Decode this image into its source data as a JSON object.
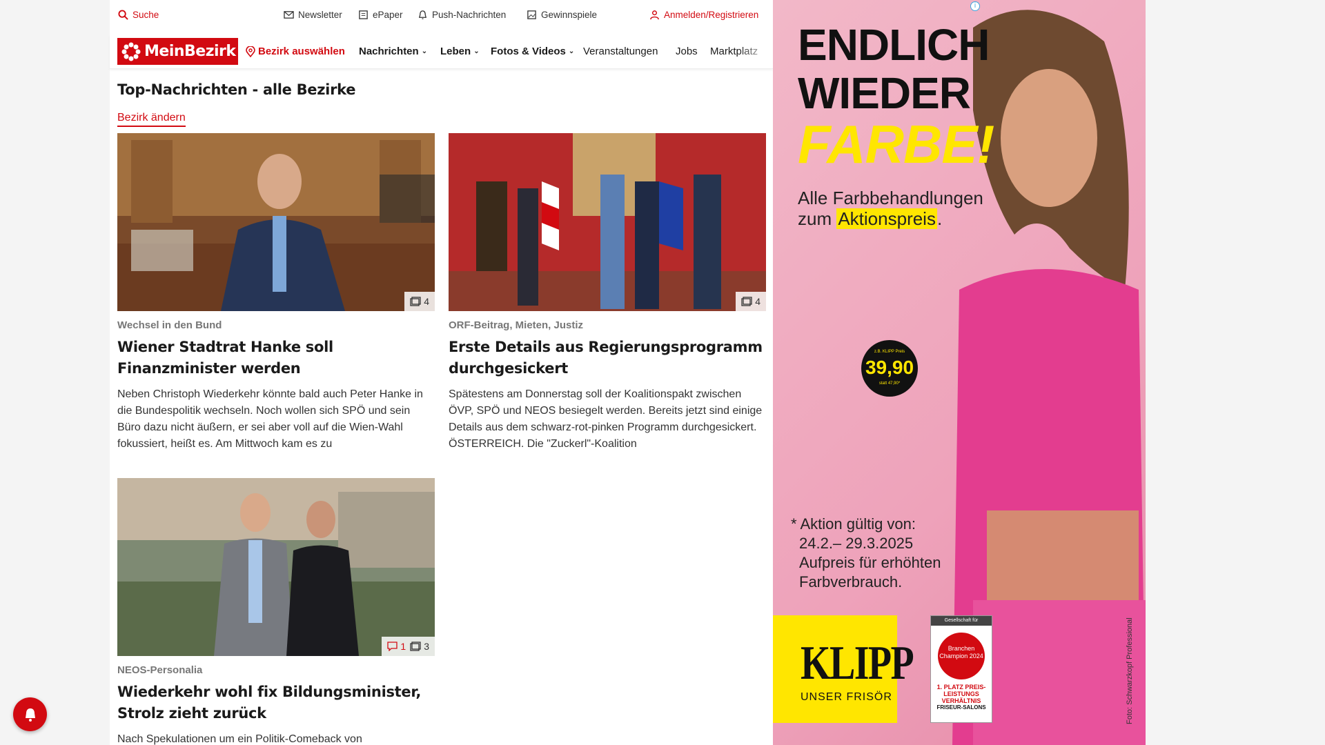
{
  "topbar": {
    "search": "Suche",
    "newsletter": "Newsletter",
    "epaper": "ePaper",
    "push": "Push-Nachrichten",
    "gewinnspiele": "Gewinnspiele",
    "login": "Anmelden/Registrieren"
  },
  "nav": {
    "logo": "MeinBezirk",
    "bezirk": "Bezirk auswählen",
    "items": [
      "Nachrichten",
      "Leben",
      "Fotos & Videos",
      "Veranstaltungen",
      "Jobs",
      "Marktplatz"
    ]
  },
  "section": {
    "title": "Top-Nachrichten - alle Bezirke",
    "change": "Bezirk ändern"
  },
  "articles": [
    {
      "category": "Wechsel in den Bund",
      "title": "Wiener Stadtrat Hanke soll Finanzminister werden",
      "teaser": "Neben Christoph Wiederkehr könnte bald auch Peter Hanke in die Bundespolitik wechseln. Noch wollen sich SPÖ und sein Büro dazu nicht äußern, er sei aber voll auf die Wien-Wahl fokussiert, heißt es. Am Mittwoch kam es zu",
      "images": "4"
    },
    {
      "category": "ORF-Beitrag, Mieten, Justiz",
      "title": "Erste Details aus Regierungsprogramm durchgesickert",
      "teaser": "Spätestens am Donnerstag soll der Koalitionspakt zwischen ÖVP, SPÖ und NEOS besiegelt werden. Bereits jetzt sind einige Details aus dem schwarz-rot-pinken Programm durchgesickert.  ÖSTERREICH. Die \"Zuckerl\"-Koalition",
      "images": "4"
    },
    {
      "category": "NEOS-Personalia",
      "title": "Wiederkehr wohl fix Bildungsminister, Strolz zieht zurück",
      "teaser": "Nach Spekulationen um ein Politik-Comeback von",
      "comments": "1",
      "images": "3"
    }
  ],
  "ad": {
    "line1": "ENDLICH",
    "line2": "WIEDER",
    "line3": "FARBE!",
    "sub1": "Alle Farbbehandlungen",
    "sub2a": "zum ",
    "sub2b": "Aktionspreis",
    "sub2c": ".",
    "price_pre": "z.B. KLIPP Preis",
    "price": "39,90",
    "price_post": "statt 47,90*",
    "cond1": "* Aktion gültig von:",
    "cond2": "24.2.– 29.3.2025",
    "cond3": "Aufpreis für erhöhten",
    "cond4": "Farbverbrauch.",
    "brand": "KLIPP",
    "brand_sub": "UNSER FRISÖR",
    "seal_top": "Gesellschaft für Verbraucherstudien GmbH",
    "seal_ring": "Branchen Champion 2024",
    "seal_place": "1. PLATZ PREIS-LEISTUNGS VERHÄLTNIS",
    "seal_bottom": "FRISEUR-SALONS",
    "credit": "Foto: Schwarzkopf Professional",
    "info": "i"
  }
}
